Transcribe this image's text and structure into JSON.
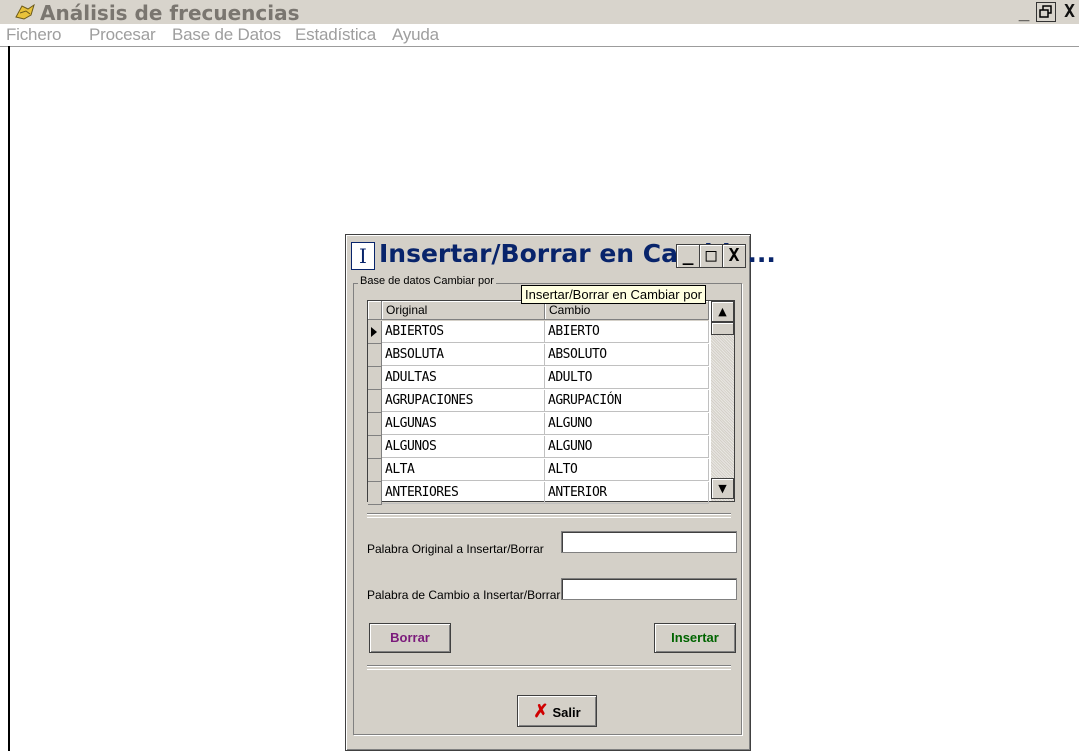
{
  "window": {
    "title": "Análisis de frecuencias",
    "controls": {
      "minimize": "_",
      "restore": "ꟷ",
      "close": "X"
    }
  },
  "menu": [
    "Fichero",
    "Procesar",
    "Base de Datos",
    "Estadística",
    "Ayuda"
  ],
  "dialog": {
    "title": "Insertar/Borrar en Cambia...",
    "icon_glyph": "I",
    "controls": {
      "minimize": "_",
      "maximize": "□",
      "close": "X"
    },
    "group_label": "Base de datos Cambiar por",
    "tooltip": "Insertar/Borrar en Cambiar por",
    "columns": [
      "Original",
      "Cambio"
    ],
    "rows": [
      [
        "ABIERTOS",
        "ABIERTO"
      ],
      [
        "ABSOLUTA",
        "ABSOLUTO"
      ],
      [
        "ADULTAS",
        "ADULTO"
      ],
      [
        "AGRUPACIONES",
        "AGRUPACIÓN"
      ],
      [
        "ALGUNAS",
        "ALGUNO"
      ],
      [
        "ALGUNOS",
        "ALGUNO"
      ],
      [
        "ALTA",
        "ALTO"
      ],
      [
        "ANTERIORES",
        "ANTERIOR"
      ]
    ],
    "selected_row_index": 0,
    "field_original_label": "Palabra Original a Insertar/Borrar",
    "field_original_value": "",
    "field_cambio_label": "Palabra de Cambio a Insertar/Borrar",
    "field_cambio_value": "",
    "borrar_label": "Borrar",
    "insertar_label": "Insertar",
    "salir_label": "Salir",
    "colors": {
      "borrar": "#7b1a7b",
      "insertar": "#006400",
      "salir_x": "#d00000",
      "title": "#08246b"
    }
  }
}
